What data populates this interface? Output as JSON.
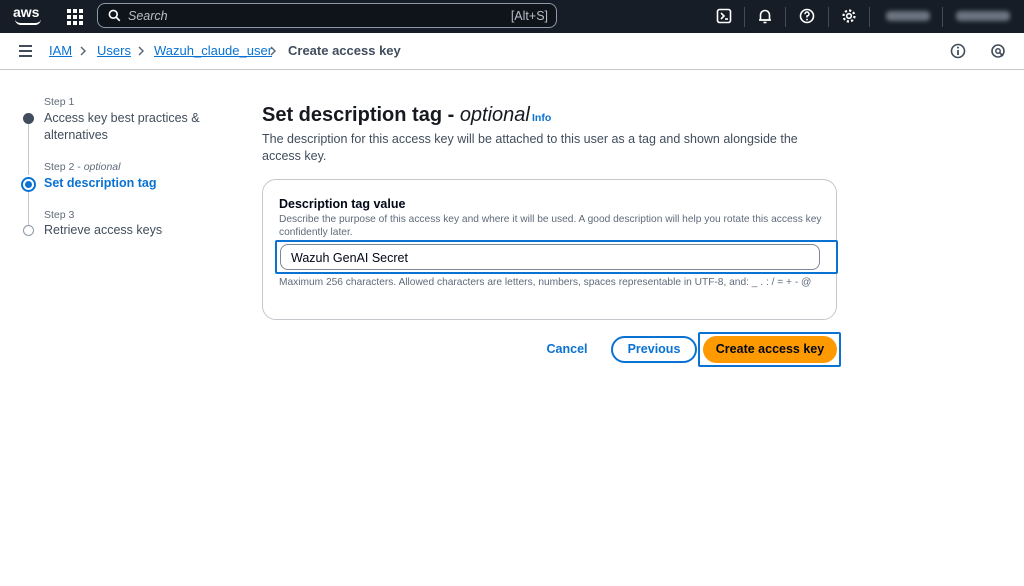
{
  "topnav": {
    "logo": "aws",
    "search_placeholder": "Search",
    "search_shortcut": "[Alt+S]",
    "icons": [
      "cloudshell-icon",
      "bell-icon",
      "help-icon",
      "gear-icon"
    ]
  },
  "breadcrumb": {
    "items": [
      "IAM",
      "Users",
      "Wazuh_claude_user",
      "Create access key"
    ]
  },
  "steps": [
    {
      "step_label": "Step 1",
      "optional": "",
      "title": "Access key best practices & alternatives",
      "state": "completed"
    },
    {
      "step_label": "Step 2 - ",
      "optional": "optional",
      "title": "Set description tag",
      "state": "active"
    },
    {
      "step_label": "Step 3",
      "optional": "",
      "title": "Retrieve access keys",
      "state": "pending"
    }
  ],
  "main": {
    "title": "Set description tag - ",
    "title_optional": "optional",
    "info_link": "Info",
    "description": "The description for this access key will be attached to this user as a tag and shown alongside the access key."
  },
  "form": {
    "label": "Description tag value",
    "help": "Describe the purpose of this access key and where it will be used. A good description will help you rotate this access key confidently later.",
    "value": "Wazuh GenAI Secret",
    "constraint": "Maximum 256 characters. Allowed characters are letters, numbers, spaces representable in UTF-8, and: _ . : / = + - @"
  },
  "actions": {
    "cancel": "Cancel",
    "previous": "Previous",
    "create": "Create access key"
  },
  "colors": {
    "nav_bg": "#161d26",
    "link": "#0972d3",
    "primary_button": "#ff9900"
  }
}
